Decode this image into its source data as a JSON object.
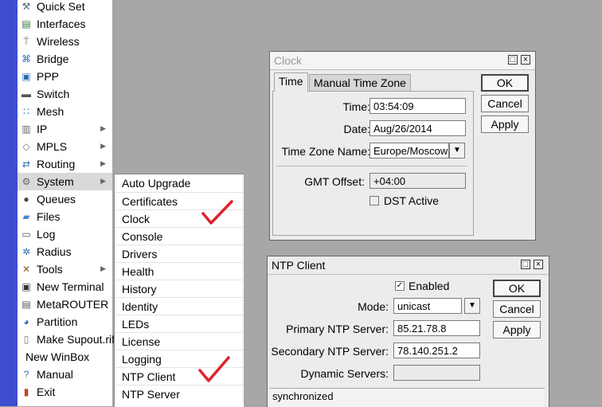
{
  "sidebar": {
    "items": [
      {
        "label": "Quick Set",
        "icon": "wrench-hammer-icon",
        "glyph": "⚒",
        "color": "#4a6a8a"
      },
      {
        "label": "Interfaces",
        "icon": "interfaces-icon",
        "glyph": "▤",
        "color": "#2f7a2f"
      },
      {
        "label": "Wireless",
        "icon": "wireless-antenna-icon",
        "glyph": "⍡",
        "color": "#555555"
      },
      {
        "label": "Bridge",
        "icon": "bridge-icon",
        "glyph": "⌘",
        "color": "#2d6fb3"
      },
      {
        "label": "PPP",
        "icon": "ppp-icon",
        "glyph": "▣",
        "color": "#2d6fb3"
      },
      {
        "label": "Switch",
        "icon": "switch-icon",
        "glyph": "▬",
        "color": "#555555"
      },
      {
        "label": "Mesh",
        "icon": "mesh-icon",
        "glyph": "∷",
        "color": "#2d6fb3"
      },
      {
        "label": "IP",
        "icon": "ip-icon",
        "glyph": "▥",
        "color": "#666666",
        "arrow": true
      },
      {
        "label": "MPLS",
        "icon": "mpls-icon",
        "glyph": "◇",
        "color": "#777777",
        "arrow": true
      },
      {
        "label": "Routing",
        "icon": "routing-icon",
        "glyph": "⇄",
        "color": "#2d6fb3",
        "arrow": true
      },
      {
        "label": "System",
        "icon": "gear-icon",
        "glyph": "⚙",
        "color": "#666666",
        "arrow": true,
        "active": true
      },
      {
        "label": "Queues",
        "icon": "queues-icon",
        "glyph": "●",
        "color": "#444444"
      },
      {
        "label": "Files",
        "icon": "folder-icon",
        "glyph": "▰",
        "color": "#4a88c8"
      },
      {
        "label": "Log",
        "icon": "log-icon",
        "glyph": "▭",
        "color": "#555555"
      },
      {
        "label": "Radius",
        "icon": "radius-icon",
        "glyph": "✲",
        "color": "#2d6fb3"
      },
      {
        "label": "Tools",
        "icon": "tools-icon",
        "glyph": "✕",
        "color": "#8a5a2a",
        "arrow": true
      },
      {
        "label": "New Terminal",
        "icon": "terminal-icon",
        "glyph": "▣",
        "color": "#333333"
      },
      {
        "label": "MetaROUTER",
        "icon": "metarouter-icon",
        "glyph": "▤",
        "color": "#555555"
      },
      {
        "label": "Partition",
        "icon": "partition-icon",
        "glyph": "◕",
        "color": "#2d6fb3"
      },
      {
        "label": "Make Supout.rif",
        "icon": "supout-document-icon",
        "glyph": "▯",
        "color": "#777777"
      },
      {
        "label": "New WinBox",
        "icon": "",
        "glyph": "",
        "color": ""
      },
      {
        "label": "Manual",
        "icon": "help-icon",
        "glyph": "?",
        "color": "#2d6fb3"
      },
      {
        "label": "Exit",
        "icon": "exit-icon",
        "glyph": "▮",
        "color": "#b84a2a"
      }
    ]
  },
  "system_submenu": {
    "items": [
      "Auto Upgrade",
      "Certificates",
      "Clock",
      "Console",
      "Drivers",
      "Health",
      "History",
      "Identity",
      "LEDs",
      "License",
      "Logging",
      "NTP Client",
      "NTP Server"
    ]
  },
  "check_color": "#e0222a",
  "clock_window": {
    "title": "Clock",
    "tabs": [
      "Time",
      "Manual Time Zone"
    ],
    "time_label": "Time:",
    "time_value": "03:54:09",
    "date_label": "Date:",
    "date_value": "Aug/26/2014",
    "tz_label": "Time Zone Name:",
    "tz_value": "Europe/Moscow",
    "gmt_label": "GMT Offset:",
    "gmt_value": "+04:00",
    "dst_label": "DST Active",
    "buttons": {
      "ok": "OK",
      "cancel": "Cancel",
      "apply": "Apply"
    }
  },
  "ntp_window": {
    "title": "NTP Client",
    "enabled_label": "Enabled",
    "mode_label": "Mode:",
    "mode_value": "unicast",
    "primary_label": "Primary NTP Server:",
    "primary_value": "85.21.78.8",
    "secondary_label": "Secondary NTP Server:",
    "secondary_value": "78.140.251.2",
    "dynamic_label": "Dynamic Servers:",
    "dynamic_value": "",
    "status": "synchronized",
    "buttons": {
      "ok": "OK",
      "cancel": "Cancel",
      "apply": "Apply"
    }
  }
}
